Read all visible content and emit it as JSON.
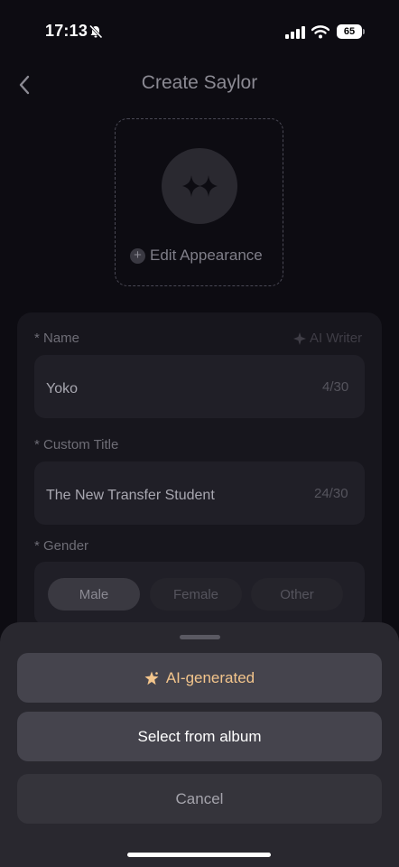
{
  "status_bar": {
    "time": "17:13",
    "battery": "65"
  },
  "header": {
    "title": "Create Saylor"
  },
  "appearance": {
    "edit_label": "Edit Appearance"
  },
  "form": {
    "ai_writer_label": "AI Writer",
    "name": {
      "label": "* Name",
      "value": "Yoko",
      "counter": "4/30"
    },
    "custom_title": {
      "label": "* Custom Title",
      "value": "The New Transfer Student",
      "counter": "24/30"
    },
    "gender": {
      "label": "* Gender",
      "options": [
        "Male",
        "Female",
        "Other"
      ],
      "selected": "Male"
    }
  },
  "sheet": {
    "ai_generated_label": "AI-generated",
    "album_label": "Select from album",
    "cancel_label": "Cancel"
  },
  "colors": {
    "accent": "#f3c58c",
    "sheet_bg": "#29282f",
    "page_bg": "#0d0c12"
  }
}
